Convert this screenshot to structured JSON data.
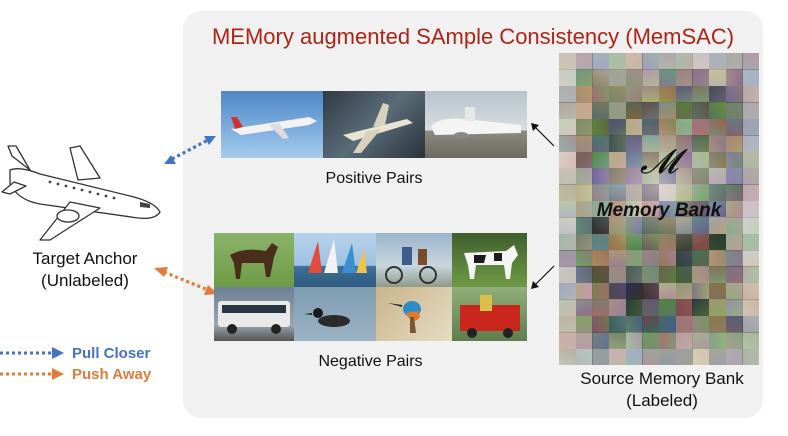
{
  "title": "MEMory augmented SAmple Consistency (MemSAC)",
  "target": {
    "label_line1": "Target Anchor",
    "label_line2": "(Unlabeled)"
  },
  "positive": {
    "caption": "Positive Pairs",
    "images": [
      "airliner-in-flight",
      "small-jet-in-flight",
      "parked-airliner"
    ]
  },
  "negative": {
    "caption": "Negative Pairs",
    "images": [
      "horse",
      "sailboats",
      "cyclists",
      "cow",
      "bus",
      "duck",
      "kingfisher",
      "fire-truck"
    ]
  },
  "memory_bank": {
    "symbol": "𝓜",
    "name": "Memory Bank",
    "caption_line1": "Source Memory Bank",
    "caption_line2": "(Labeled)"
  },
  "legend": {
    "pull": "Pull Closer",
    "push": "Push Away"
  },
  "colors": {
    "title": "#b02418",
    "pull": "#4472c4",
    "push": "#e07b39",
    "panel": "#f1f1f1"
  },
  "icons": [
    "airplane-sketch-icon",
    "pull-arrow-icon",
    "push-arrow-icon"
  ]
}
